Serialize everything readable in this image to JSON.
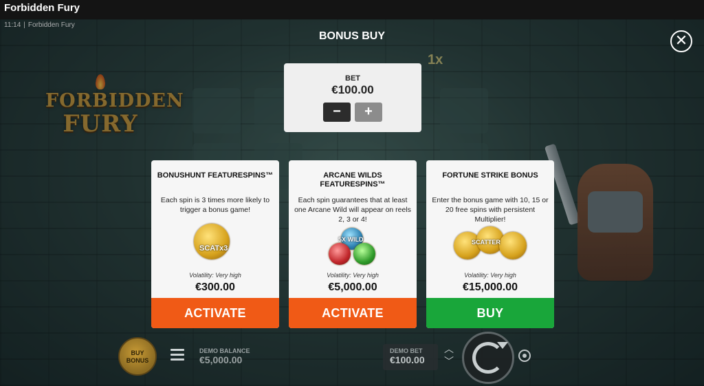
{
  "window": {
    "title": "Forbidden Fury"
  },
  "status": {
    "time": "11:14",
    "separator": "|",
    "app": "Forbidden Fury"
  },
  "logo": {
    "line1": "FORBIDDEN",
    "line2": "FURY"
  },
  "reels": {
    "multiplier": "1x"
  },
  "bonus_panel": {
    "title": "BONUS BUY",
    "close_icon": "close-icon",
    "bet": {
      "label": "BET",
      "value": "€100.00",
      "minus": "−",
      "plus": "+"
    },
    "cards": [
      {
        "title": "BONUSHUNT FEATURESPINS™",
        "description": "Each spin is 3 times more likely to trigger a bonus game!",
        "volatility": "Volatility: Very high",
        "price": "€300.00",
        "action": "ACTIVATE",
        "art_text": "SCATx3"
      },
      {
        "title": "ARCANE WILDS FEATURESPINS™",
        "description": "Each spin guarantees that at least one Arcane Wild will appear on reels 2, 3 or 4!",
        "volatility": "Volatility: Very high",
        "price": "€5,000.00",
        "action": "ACTIVATE",
        "art_text": "5X WILD"
      },
      {
        "title": "FORTUNE STRIKE BONUS",
        "description": "Enter the bonus game with 10, 15 or 20 free spins with persistent Multiplier!",
        "volatility": "Volatility: Very high",
        "price": "€15,000.00",
        "action": "BUY",
        "art_text": "SCATTER"
      }
    ]
  },
  "bottom_bar": {
    "buy_bonus": "BUY BONUS",
    "balance_label": "DEMO BALANCE",
    "balance_value": "€5,000.00",
    "bet_label": "DEMO BET",
    "bet_value": "€100.00"
  },
  "colors": {
    "activate": "#f05a16",
    "buy": "#19a63a"
  }
}
